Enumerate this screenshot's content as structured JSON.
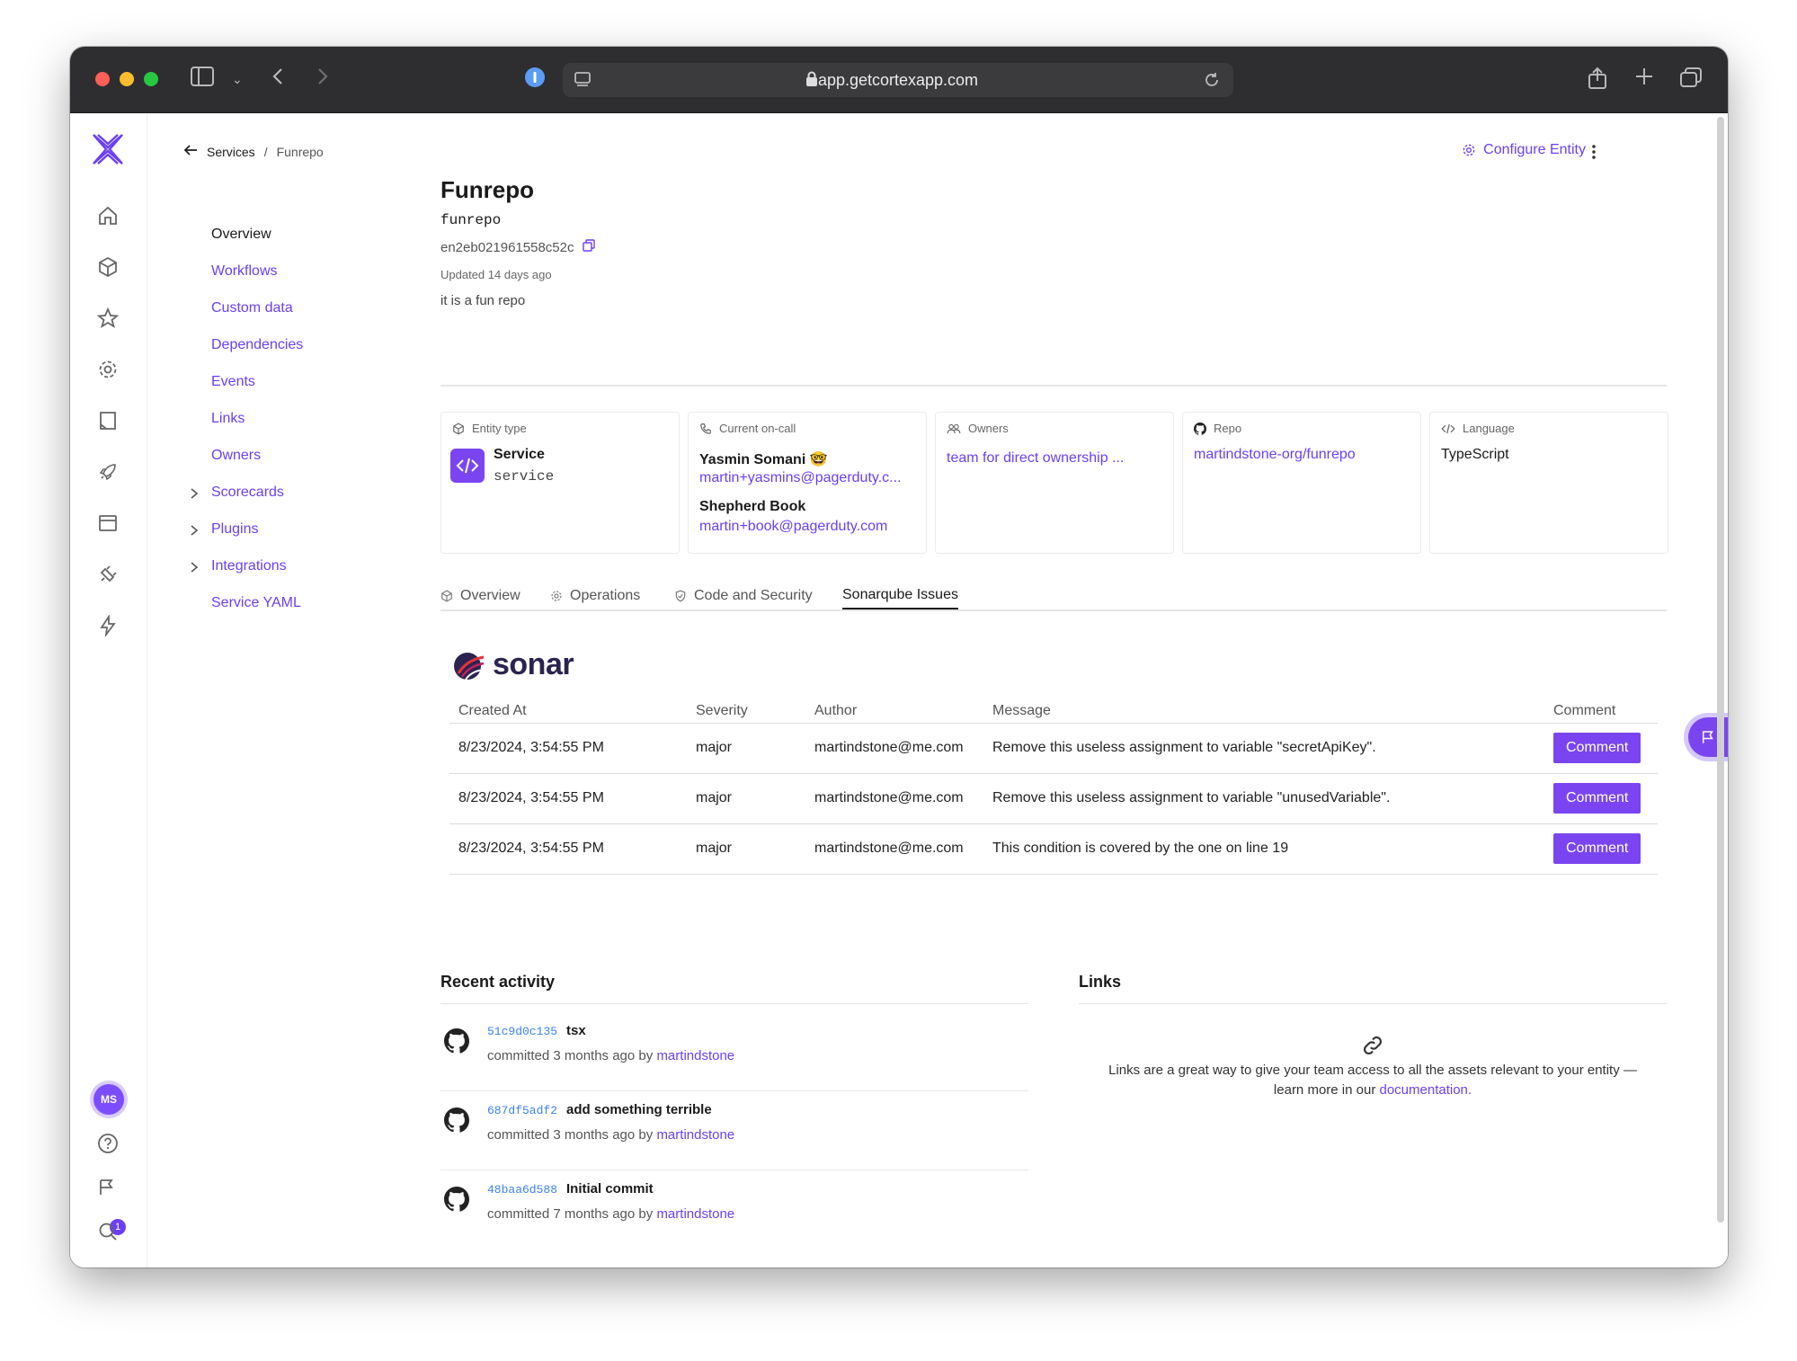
{
  "browser": {
    "url": "app.getcortexapp.com"
  },
  "breadcrumb": {
    "services": "Services",
    "separator": "/",
    "current": "Funrepo"
  },
  "subnav": {
    "overview": "Overview",
    "workflows": "Workflows",
    "custom_data": "Custom data",
    "dependencies": "Dependencies",
    "events": "Events",
    "links": "Links",
    "owners": "Owners",
    "scorecards": "Scorecards",
    "plugins": "Plugins",
    "integrations": "Integrations",
    "service_yaml": "Service YAML"
  },
  "header": {
    "configure_label": "Configure Entity"
  },
  "entity": {
    "name": "Funrepo",
    "tag": "funrepo",
    "id": "en2eb021961558c52c",
    "updated": "Updated 14 days ago",
    "description": "it is a fun repo"
  },
  "cards": {
    "entity_type": {
      "label": "Entity type",
      "name": "Service",
      "value": "service"
    },
    "oncall": {
      "label": "Current on-call",
      "person1_name": "Yasmin Somani 🤓",
      "person1_email": "martin+yasmins@pagerduty.c...",
      "person2_name": "Shepherd Book",
      "person2_email": "martin+book@pagerduty.com"
    },
    "owners": {
      "label": "Owners",
      "value": "team for direct ownership ..."
    },
    "repo": {
      "label": "Repo",
      "value": "martindstone-org/funrepo"
    },
    "language": {
      "label": "Language",
      "value": "TypeScript"
    }
  },
  "tabs": {
    "overview": "Overview",
    "operations": "Operations",
    "code_security": "Code and Security",
    "sonarqube": "Sonarqube Issues"
  },
  "sonar": {
    "logo_text": "sonar",
    "columns": [
      "Created At",
      "Severity",
      "Author",
      "Message",
      "Comment"
    ],
    "rows": [
      {
        "created": "8/23/2024, 3:54:55 PM",
        "severity": "major",
        "author": "martindstone@me.com",
        "message": "Remove this useless assignment to variable \"secretApiKey\".",
        "button": "Comment"
      },
      {
        "created": "8/23/2024, 3:54:55 PM",
        "severity": "major",
        "author": "martindstone@me.com",
        "message": "Remove this useless assignment to variable \"unusedVariable\".",
        "button": "Comment"
      },
      {
        "created": "8/23/2024, 3:54:55 PM",
        "severity": "major",
        "author": "martindstone@me.com",
        "message": "This condition is covered by the one on line 19",
        "button": "Comment"
      }
    ]
  },
  "activity": {
    "title": "Recent activity",
    "commits": [
      {
        "sha": "51c9d0c135",
        "message": "tsx",
        "meta": "committed 3 months ago by",
        "user": "martindstone"
      },
      {
        "sha": "687df5adf2",
        "message": "add something terrible",
        "meta": "committed 3 months ago by",
        "user": "martindstone"
      },
      {
        "sha": "48baa6d588",
        "message": "Initial commit",
        "meta": "committed 7 months ago by",
        "user": "martindstone"
      }
    ]
  },
  "links_section": {
    "title": "Links",
    "empty_text": "Links are a great way to give your team access to all the assets relevant to your entity — learn more in our",
    "doc_link": "documentation."
  },
  "user": {
    "initials": "MS",
    "notifications": "1"
  },
  "colors": {
    "accent": "#6b3ff4",
    "button": "#7a45f0",
    "sha": "#3b82f6"
  }
}
